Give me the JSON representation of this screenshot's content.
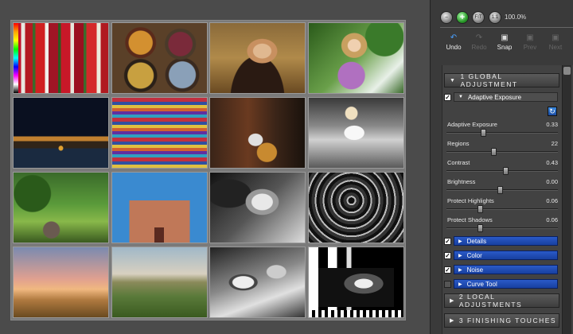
{
  "grid": {
    "thumbnails": [
      {
        "subject": "red-peppers"
      },
      {
        "subject": "bowls-of-food"
      },
      {
        "subject": "woman-portrait"
      },
      {
        "subject": "girl-in-garden"
      },
      {
        "subject": "night-city"
      },
      {
        "subject": "striped-fabric"
      },
      {
        "subject": "cello-player"
      },
      {
        "subject": "mannequins"
      },
      {
        "subject": "garden-urn"
      },
      {
        "subject": "adobe-church"
      },
      {
        "subject": "bw-face"
      },
      {
        "subject": "bw-spiral-staircase"
      },
      {
        "subject": "dusk-hills"
      },
      {
        "subject": "rolling-hills"
      },
      {
        "subject": "bw-bicycle"
      },
      {
        "subject": "bw-test-chart"
      }
    ]
  },
  "zoom": {
    "buttons": [
      {
        "icon": "zoom-out-icon",
        "glyph": "–"
      },
      {
        "icon": "zoom-in-icon",
        "glyph": "+"
      },
      {
        "icon": "fit-icon",
        "glyph": "FIT"
      },
      {
        "icon": "one-to-one-icon",
        "glyph": "1:1"
      }
    ],
    "level": "100.0%"
  },
  "toolbar": {
    "undo": "Undo",
    "redo": "Redo",
    "snap": "Snap",
    "prev": "Prev",
    "next": "Next"
  },
  "global": {
    "title": "1 GLOBAL ADJUSTMENT",
    "adaptive_exposure": {
      "title": "Adaptive Exposure",
      "checked": true,
      "sliders": [
        {
          "label": "Adaptive Exposure",
          "value": "0.33",
          "position": 0.33
        },
        {
          "label": "Regions",
          "value": "22",
          "position": 0.42
        },
        {
          "label": "Contrast",
          "value": "0.43",
          "position": 0.53
        },
        {
          "label": "Brightness",
          "value": "0.00",
          "position": 0.48
        },
        {
          "label": "Protect Highlights",
          "value": "0.06",
          "position": 0.3
        },
        {
          "label": "Protect Shadows",
          "value": "0.06",
          "position": 0.3
        }
      ]
    },
    "subsections": [
      {
        "title": "Details",
        "checked": true
      },
      {
        "title": "Color",
        "checked": true
      },
      {
        "title": "Noise",
        "checked": true
      },
      {
        "title": "Curve Tool",
        "checked": false
      }
    ]
  },
  "local": {
    "title": "2 LOCAL ADJUSTMENTS"
  },
  "finishing": {
    "title": "3 FINISHING TOUCHES"
  },
  "colors": {
    "accent_blue": "#1e4cb4",
    "panel": "#3a3a3a",
    "canvas": "#4b4b4b"
  }
}
